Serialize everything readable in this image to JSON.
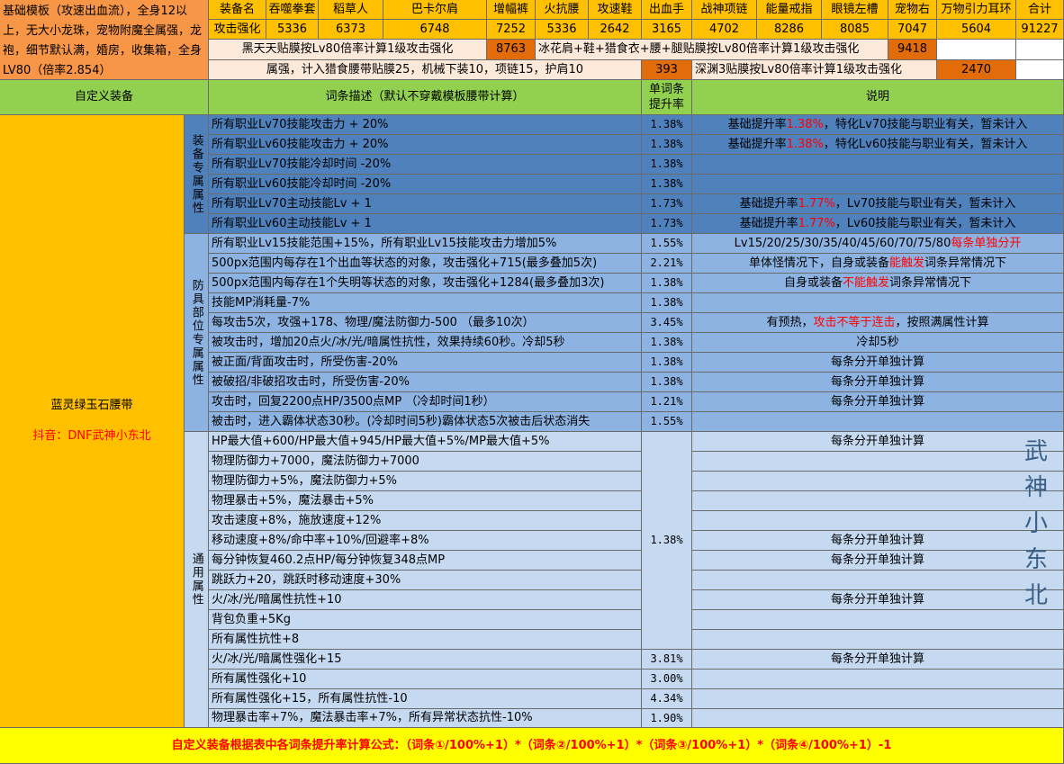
{
  "template_desc": "基础模板（攻速出血流），全身12以上，无大小龙珠，宠物附魔全属强，龙袍，细节默认满，婚房，收集箱，全身LV80（倍率2.854）",
  "header": {
    "label": "装备名",
    "items": [
      "吞噬拳套",
      "稻草人",
      "巴卡尔肩",
      "增幅裤",
      "火抗腰",
      "攻速鞋",
      "出血手",
      "战神项链",
      "能量戒指",
      "眼镜左槽",
      "宠物右",
      "万物引力耳环",
      "合计"
    ]
  },
  "atk": {
    "label": "攻击强化",
    "values": [
      "5336",
      "6373",
      "6748",
      "7252",
      "5336",
      "2642",
      "3165",
      "4702",
      "8286",
      "8085",
      "7047",
      "5604",
      "91227"
    ]
  },
  "row3": {
    "desc1": "黑天天贴膜按Lv80倍率计算1级攻击强化",
    "val1": "8763",
    "desc2": "冰花肩+鞋+猎食衣+腰+腿贴膜按Lv80倍率计算1级攻击强化",
    "val2": "9418"
  },
  "row4": {
    "desc1": "属强，计入猎食腰带贴膜25，机械下装10，项链15，护肩10",
    "val1": "393",
    "desc2": "深渊3贴膜按Lv80倍率计算1级攻击强化",
    "val2": "2470"
  },
  "table_header": {
    "custom": "自定义装备",
    "desc": "词条描述（默认不穿戴模板腰带计算）",
    "rate": "单词条提升率",
    "note": "说明"
  },
  "left": {
    "item_name": "蓝灵绿玉石腰带",
    "douyin": "抖音：DNF武神小东北"
  },
  "groups": {
    "g1": "装备专属属性",
    "g2": "防具部位专属属性",
    "g3": "通用属性"
  },
  "rows": [
    {
      "desc": "所有职业Lv70技能攻击力 + 20%",
      "rate": "1.38%",
      "note": "基础提升率1.38%，特化Lv70技能与职业有关，暂未计入",
      "note_pre": "基础提升率",
      "note_red": "1.38%",
      "note_post": "，特化Lv70技能与职业有关，暂未计入"
    },
    {
      "desc": "所有职业Lv60技能攻击力 + 20%",
      "rate": "1.38%",
      "note": "基础提升率1.38%，特化Lv60技能与职业有关，暂未计入",
      "note_pre": "基础提升率",
      "note_red": "1.38%",
      "note_post": "，特化Lv60技能与职业有关，暂未计入"
    },
    {
      "desc": "所有职业Lv70技能冷却时间 -20%",
      "rate": "1.38%",
      "note": "",
      "note_pre": "",
      "note_red": "",
      "note_post": ""
    },
    {
      "desc": "所有职业Lv60技能冷却时间 -20%",
      "rate": "1.38%",
      "note": "",
      "note_pre": "",
      "note_red": "",
      "note_post": ""
    },
    {
      "desc": "所有职业Lv70主动技能Lv + 1",
      "rate": "1.73%",
      "note": "基础提升率1.77%，Lv70技能与职业有关，暂未计入",
      "note_pre": "基础提升率",
      "note_red": "1.77%",
      "note_post": "，Lv70技能与职业有关，暂未计入"
    },
    {
      "desc": "所有职业Lv60主动技能Lv + 1",
      "rate": "1.73%",
      "note": "基础提升率1.77%，Lv60技能与职业有关，暂未计入",
      "note_pre": "基础提升率",
      "note_red": "1.77%",
      "note_post": "，Lv60技能与职业有关，暂未计入"
    },
    {
      "desc": "所有职业Lv15技能范围+15%，所有职业Lv15技能攻击力增加5%",
      "rate": "1.55%",
      "note": "",
      "note_pre": "Lv15/20/25/30/35/40/45/60/70/75/80",
      "note_red": "每条单独分开",
      "note_post": ""
    },
    {
      "desc": "500px范围内每存在1个出血等状态的对象，攻击强化+715(最多叠加5次)",
      "rate": "2.21%",
      "note": "",
      "note_pre": "单体怪情况下，自身或装备",
      "note_red": "能触发",
      "note_post": "词条异常情况下"
    },
    {
      "desc": "500px范围内每存在1个失明等状态的对象，攻击强化+1284(最多叠加3次)",
      "rate": "1.38%",
      "note": "",
      "note_pre": "自身或装备",
      "note_red": "不能触发",
      "note_post": "词条异常情况下"
    },
    {
      "desc": "技能MP消耗量-7%",
      "rate": "1.38%",
      "note": "",
      "note_pre": "",
      "note_red": "",
      "note_post": ""
    },
    {
      "desc": "每攻击5次，攻强+178、物理/魔法防御力-500 （最多10次）",
      "rate": "3.45%",
      "note": "",
      "note_pre": "有预热，",
      "note_red": "攻击不等于连击",
      "note_post": "，按照满属性计算"
    },
    {
      "desc": "被攻击时，增加20点火/冰/光/暗属性抗性，效果持续60秒。冷却5秒",
      "rate": "1.38%",
      "note": "冷却5秒",
      "note_pre": "冷却5秒",
      "note_red": "",
      "note_post": ""
    },
    {
      "desc": "被正面/背面攻击时，所受伤害-20%",
      "rate": "1.38%",
      "note": "每条分开单独计算",
      "note_pre": "每条分开单独计算",
      "note_red": "",
      "note_post": ""
    },
    {
      "desc": "被破招/非破招攻击时，所受伤害-20%",
      "rate": "1.38%",
      "note": "每条分开单独计算",
      "note_pre": "每条分开单独计算",
      "note_red": "",
      "note_post": ""
    },
    {
      "desc": "攻击时，回复2200点HP/3500点MP （冷却时间1秒）",
      "rate": "1.21%",
      "note": "每条分开单独计算",
      "note_pre": "每条分开单独计算",
      "note_red": "",
      "note_post": ""
    },
    {
      "desc": "被击时，进入霸体状态30秒。(冷却时间5秒)霸体状态5次被击后状态消失",
      "rate": "1.55%",
      "note": "",
      "note_pre": "",
      "note_red": "",
      "note_post": ""
    }
  ],
  "general_rows": [
    {
      "desc": "HP最大值+600/HP最大值+945/HP最大值+5%/MP最大值+5%",
      "note": "每条分开单独计算"
    },
    {
      "desc": "物理防御力+7000，魔法防御力+7000",
      "note": ""
    },
    {
      "desc": "物理防御力+5%，魔法防御力+5%",
      "note": ""
    },
    {
      "desc": "物理暴击+5%，魔法暴击+5%",
      "note": ""
    },
    {
      "desc": "攻击速度+8%，施放速度+12%",
      "note": ""
    },
    {
      "desc": "移动速度+8%/命中率+10%/回避率+8%",
      "note": "每条分开单独计算"
    },
    {
      "desc": "每分钟恢复460.2点HP/每分钟恢复348点MP",
      "note": "每条分开单独计算"
    },
    {
      "desc": "跳跃力+20，跳跃时移动速度+30%",
      "note": ""
    },
    {
      "desc": "火/冰/光/暗属性抗性+10",
      "note": "每条分开单独计算"
    },
    {
      "desc": "背包负重+5Kg",
      "note": ""
    },
    {
      "desc": "所有属性抗性+8",
      "note": ""
    },
    {
      "desc": "火/冰/光/暗属性强化+15",
      "note": "每条分开单独计算",
      "rate": "3.81%"
    },
    {
      "desc": "所有属性强化+10",
      "note": "",
      "rate": "3.00%"
    },
    {
      "desc": "所有属性强化+15，所有属性抗性-10",
      "note": "",
      "rate": "4.34%"
    },
    {
      "desc": "物理暴击率+7%，魔法暴击率+7%，所有异常状态抗性-10%",
      "note": "",
      "rate": "1.90%"
    }
  ],
  "general_merged_rate": "1.38%",
  "watermark": "武神小东北",
  "footer": "自定义装备根据表中各词条提升率计算公式：（词条①/100%+1）*（词条②/100%+1）*（词条③/100%+1）*（词条④/100%+1）-1",
  "colors": {
    "orange": "#f79646",
    "gold": "#ffc000",
    "green_header": "#92d050",
    "blue_dark": "#4f81bd",
    "blue_mid": "#8db3e2",
    "blue_light": "#c5d9f1",
    "footer_yellow": "#ffff00",
    "red_text": "#ff0000"
  }
}
